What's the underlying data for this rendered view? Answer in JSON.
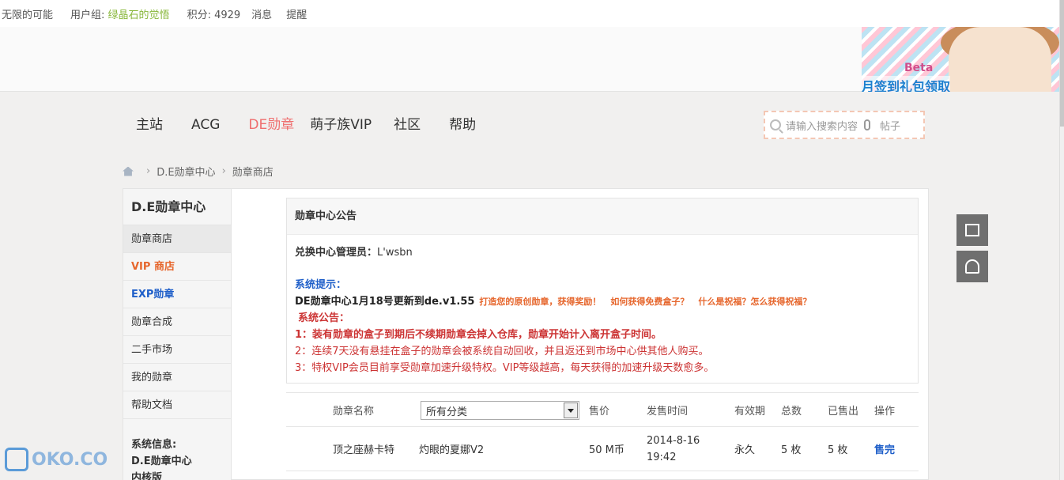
{
  "userbar": {
    "site": "无限的可能",
    "group_label": "用户组:",
    "group_name": "绿晶石的觉悟",
    "points": "积分: 4929",
    "messages": "消息",
    "reminders": "提醒"
  },
  "banner": {
    "beta": "Beta",
    "signin": "月签到礼包领取"
  },
  "nav": {
    "items": [
      "主站",
      "ACG",
      "DE勋章",
      "萌子族VIP",
      "社区",
      "帮助"
    ],
    "search_placeholder": "请输入搜索内容",
    "search_scope": "帖子"
  },
  "breadcrumb": {
    "level1": "D.E勋章中心",
    "level2": "勋章商店"
  },
  "sidebar": {
    "title": "D.E勋章中心",
    "items": [
      "勋章商店",
      "VIP 商店",
      "EXP勋章",
      "勋章合成",
      "二手市场",
      "我的勋章",
      "帮助文档"
    ],
    "sysinfo_label": "系统信息:",
    "sysinfo_line1": "D.E勋章中心",
    "sysinfo_line2": "内核版"
  },
  "notice": {
    "title": "勋章中心公告",
    "admin_label": "兑换中心管理员：",
    "admin_name": "L'wsbn",
    "tip_label": "系统提示：",
    "update": "DE勋章中心1月18号更新到de.v1.55",
    "link1": "打造您的原创勋章，获得奖励！",
    "link2": "如何获得免费盒子？",
    "link3": "什么是祝福？怎么获得祝福？",
    "ann_label": "系统公告：",
    "rule1": "1：装有勋章的盒子到期后不续期勋章会掉入仓库，勋章开始计入离开盒子时间。",
    "rule2": "2：连续7天没有悬挂在盒子的勋章会被系统自动回收，并且返还到市场中心供其他人购买。",
    "rule3": "3：特权VIP会员目前享受勋章加速升级特权。VIP等级越高，每天获得的加速升级天数愈多。"
  },
  "table": {
    "headers": {
      "name": "勋章名称",
      "category": "所有分类",
      "price": "售价",
      "date": "发售时间",
      "validity": "有效期",
      "total": "总数",
      "sold": "已售出",
      "action": "操作"
    },
    "rows": [
      {
        "name": "顶之座赫卡特",
        "name2": "灼眼的夏娜V2",
        "price": "50 M币",
        "date": "2014-8-16",
        "time": "19:42",
        "validity": "永久",
        "total": "5 枚",
        "sold": "5 枚",
        "action": "售完"
      }
    ]
  },
  "watermark": "OKO.CO"
}
